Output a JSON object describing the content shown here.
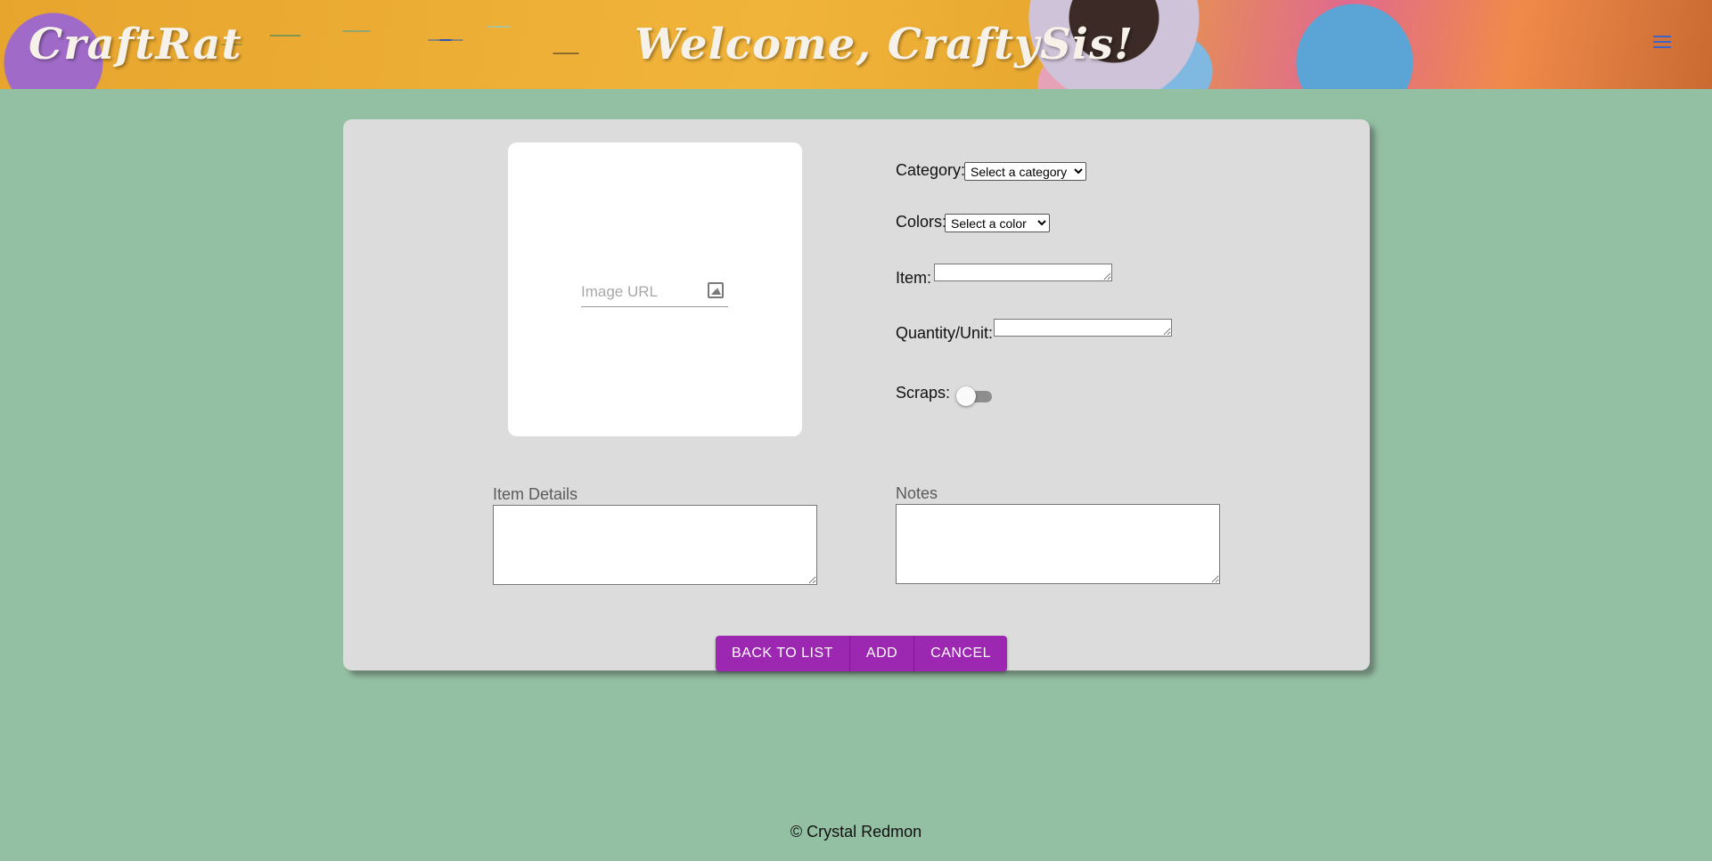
{
  "header": {
    "brand": "CraftRat",
    "welcome": "Welcome, CraftySis!",
    "menu_icon": "hamburger-menu-icon"
  },
  "form": {
    "image_url_placeholder": "Image URL",
    "image_icon": "image-icon",
    "category_label": "Category:",
    "category_selected": "Select a category",
    "colors_label": "Colors:",
    "colors_selected": "Select a color",
    "item_label": "Item:",
    "quantity_label": "Quantity/Unit:",
    "scraps_label": "Scraps:",
    "scraps_on": false,
    "item_details_label": "Item Details",
    "notes_label": "Notes"
  },
  "buttons": {
    "back": "BACK TO LIST",
    "add": "ADD",
    "cancel": "CANCEL"
  },
  "colors": {
    "background": "#93bfa2",
    "card": "#dcdcdc",
    "button": "#9c27b0"
  },
  "footer": {
    "text": "© Crystal Redmon"
  }
}
